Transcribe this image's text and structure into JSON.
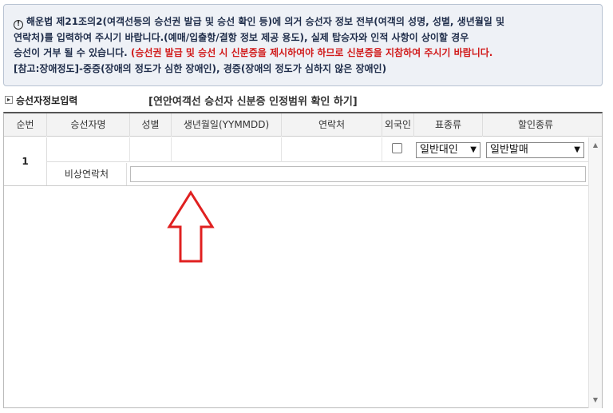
{
  "notice": {
    "icon": "exclamation-circle-icon",
    "line1": "해운법 제21조의2(여객선등의 승선권 발급 및 승선 확인 등)에 의거 승선자 정보 전부(여객의 성명, 성별, 생년월일 및",
    "line2": "연락처)를 입력하여 주시기 바랍니다.(예매/입출항/결항 정보 제공 용도), 실제 탑승자와 인적 사항이 상이할 경우",
    "line3_black": "승선이 거부 될 수 있습니다. ",
    "line3_red": "(승선권 발급 및 승선 시 신분증을 제시하여야 하므로 신분증을 지참하여 주시기 바랍니다.",
    "line4": "[참고:장애정도]-중증(장애의 정도가 심한 장애인), 경증(장애의 정도가 심하지 않은 장애인)"
  },
  "section": {
    "title": "승선자정보입력",
    "id_link": "[연안여객선 승선자 신분증 인정범위 확인 하기]"
  },
  "table": {
    "headers": [
      "순번",
      "승선자명",
      "성별",
      "생년월일(YYMMDD)",
      "연락처",
      "외국인",
      "표종류",
      "할인종류"
    ],
    "rows": [
      {
        "num": "1",
        "passenger_name": "",
        "gender": "",
        "birth": "",
        "contact": "",
        "foreigner": false,
        "ticket_type": "일반대인",
        "discount_type": "일반발매",
        "emergency_label": "비상연락처",
        "emergency_value": ""
      }
    ]
  },
  "colors": {
    "notice_bg": "#eef1f6",
    "notice_text": "#1f2d4a",
    "warning_red": "#d11a1a",
    "arrow_red": "#e02020"
  }
}
